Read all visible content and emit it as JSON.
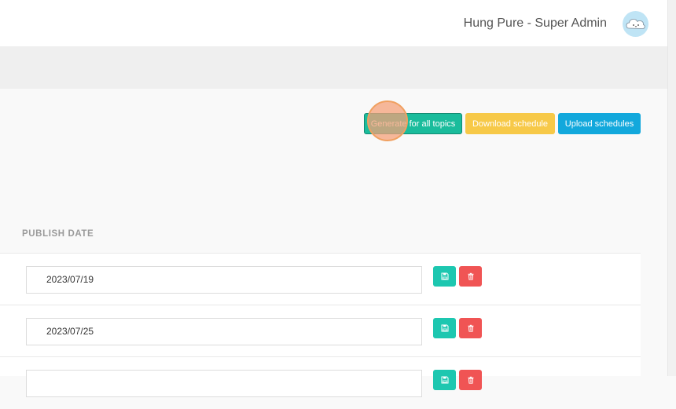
{
  "header": {
    "user_name": "Hung Pure - Super Admin",
    "avatar_icon": "cloud-avatar-icon"
  },
  "toolbar": {
    "generate_label": "Generate for all topics",
    "download_label": "Download schedule",
    "upload_label": "Upload schedules"
  },
  "table": {
    "column_header": "PUBLISH DATE",
    "rows": [
      {
        "publish_date": "2023/07/19"
      },
      {
        "publish_date": "2023/07/25"
      },
      {
        "publish_date": ""
      }
    ],
    "row_actions": {
      "save_icon": "save-icon",
      "delete_icon": "trash-icon"
    }
  },
  "colors": {
    "accent_green": "#1abc9c",
    "accent_yellow": "#f7c948",
    "accent_blue": "#12a8dc",
    "danger_red": "#f05454"
  }
}
